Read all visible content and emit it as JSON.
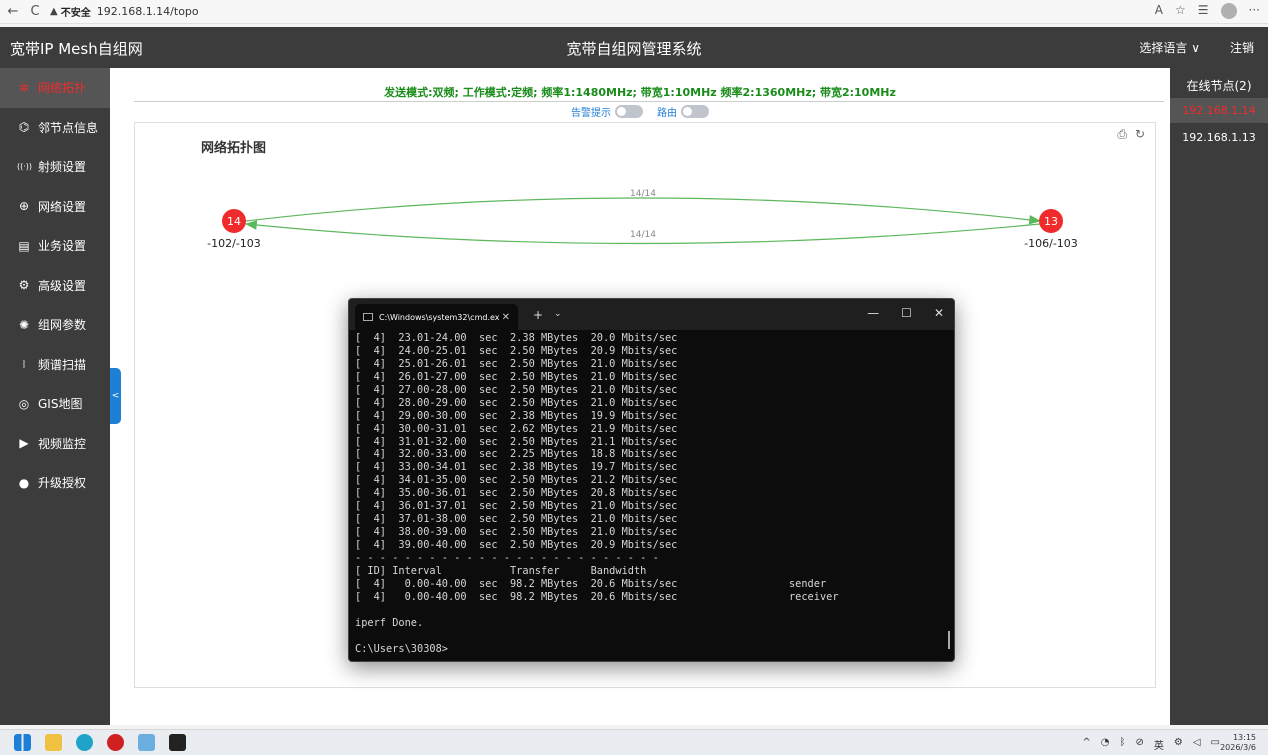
{
  "browser": {
    "back": "←",
    "reload": "C",
    "insecure_label": "不安全",
    "url": "192.168.1.14/topo"
  },
  "header": {
    "brand": "宽带IP Mesh自组网",
    "title": "宽带自组网管理系统",
    "language": "选择语言 ∨",
    "logout": "注销"
  },
  "sidebar": {
    "items": [
      {
        "label": "网络拓扑",
        "icon": "topology-icon",
        "glyph": "✲",
        "active": true
      },
      {
        "label": "邻节点信息",
        "icon": "neighbor-icon",
        "glyph": "⌬"
      },
      {
        "label": "射频设置",
        "icon": "radio-icon",
        "glyph": "((·))"
      },
      {
        "label": "网络设置",
        "icon": "globe-icon",
        "glyph": "⊕"
      },
      {
        "label": "业务设置",
        "icon": "business-icon",
        "glyph": "▤"
      },
      {
        "label": "高级设置",
        "icon": "gear-icon",
        "glyph": "⚙"
      },
      {
        "label": "组网参数",
        "icon": "network-params-icon",
        "glyph": "✺"
      },
      {
        "label": "频谱扫描",
        "icon": "spectrum-icon",
        "glyph": "⧘"
      },
      {
        "label": "GIS地图",
        "icon": "map-pin-icon",
        "glyph": "◎"
      },
      {
        "label": "视频监控",
        "icon": "video-icon",
        "glyph": "▶"
      },
      {
        "label": "升级授权",
        "icon": "upgrade-icon",
        "glyph": "●"
      }
    ]
  },
  "collapse_glyph": "<",
  "main": {
    "params": "发送模式:双频;  工作模式:定频;  频率1:1480MHz;  带宽1:10MHz   频率2:1360MHz;  带宽2:10MHz",
    "alarm_label": "告警提示",
    "route_label": "路由",
    "topo_title": "网络拓扑图",
    "tools": {
      "export": "⎙",
      "refresh": "↻"
    }
  },
  "topology": {
    "nodes": [
      {
        "id": "14",
        "signal": "-102/-103"
      },
      {
        "id": "13",
        "signal": "-106/-103"
      }
    ],
    "links": [
      {
        "label": "14/14"
      },
      {
        "label": "14/14"
      }
    ],
    "node_color": "#f02b2b",
    "link_color": "#5cb85c"
  },
  "right_panel": {
    "title": "在线节点(2)",
    "nodes": [
      {
        "ip": "192.168.1.14",
        "active": true
      },
      {
        "ip": "192.168.1.13",
        "active": false
      }
    ]
  },
  "cmd": {
    "tab_title": "C:\\Windows\\system32\\cmd.ex",
    "tab_close": "✕",
    "new_tab": "+",
    "dropdown": "⌄",
    "minimize": "—",
    "maximize": "☐",
    "close": "✕",
    "lines": [
      "[  4]  23.01-24.00  sec  2.38 MBytes  20.0 Mbits/sec",
      "[  4]  24.00-25.01  sec  2.50 MBytes  20.9 Mbits/sec",
      "[  4]  25.01-26.01  sec  2.50 MBytes  21.0 Mbits/sec",
      "[  4]  26.01-27.00  sec  2.50 MBytes  21.0 Mbits/sec",
      "[  4]  27.00-28.00  sec  2.50 MBytes  21.0 Mbits/sec",
      "[  4]  28.00-29.00  sec  2.50 MBytes  21.0 Mbits/sec",
      "[  4]  29.00-30.00  sec  2.38 MBytes  19.9 Mbits/sec",
      "[  4]  30.00-31.01  sec  2.62 MBytes  21.9 Mbits/sec",
      "[  4]  31.01-32.00  sec  2.50 MBytes  21.1 Mbits/sec",
      "[  4]  32.00-33.00  sec  2.25 MBytes  18.8 Mbits/sec",
      "[  4]  33.00-34.01  sec  2.38 MBytes  19.7 Mbits/sec",
      "[  4]  34.01-35.00  sec  2.50 MBytes  21.2 Mbits/sec",
      "[  4]  35.00-36.01  sec  2.50 MBytes  20.8 Mbits/sec",
      "[  4]  36.01-37.01  sec  2.50 MBytes  21.0 Mbits/sec",
      "[  4]  37.01-38.00  sec  2.50 MBytes  21.0 Mbits/sec",
      "[  4]  38.00-39.00  sec  2.50 MBytes  21.0 Mbits/sec",
      "[  4]  39.00-40.00  sec  2.50 MBytes  20.9 Mbits/sec",
      "- - - - - - - - - - - - - - - - - - - - - - - - -",
      "[ ID] Interval           Transfer     Bandwidth",
      "[  4]   0.00-40.00  sec  98.2 MBytes  20.6 Mbits/sec                  sender",
      "[  4]   0.00-40.00  sec  98.2 MBytes  20.6 Mbits/sec                  receiver",
      "",
      "iperf Done.",
      "",
      "C:\\Users\\30308>"
    ]
  },
  "taskbar": {
    "tray_lang": "英",
    "time": "13:15",
    "date": "2026/3/6"
  }
}
